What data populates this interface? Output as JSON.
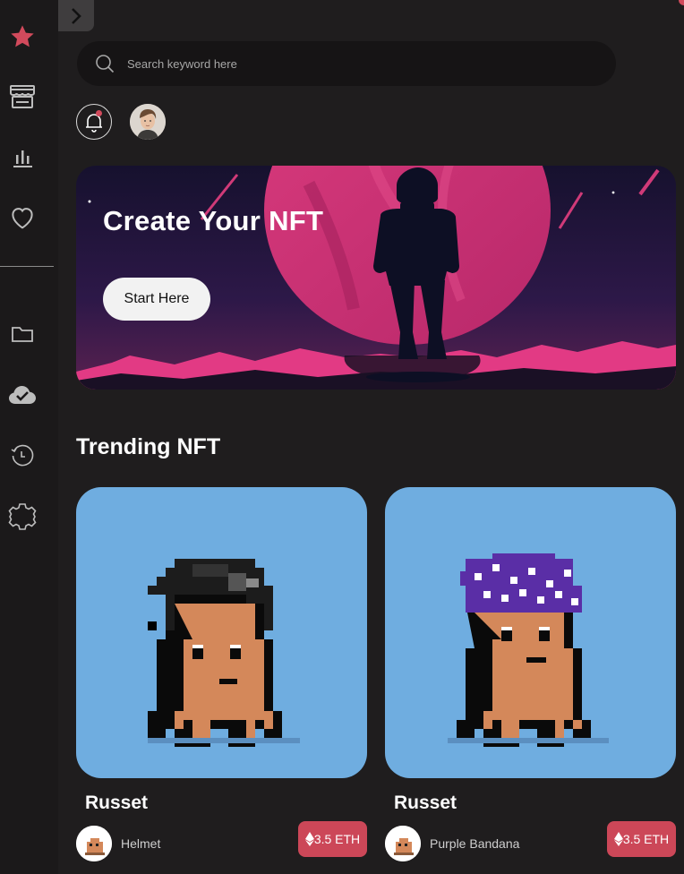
{
  "sidebar": {
    "items": [
      {
        "icon": "star-icon",
        "active": true
      },
      {
        "icon": "store-icon"
      },
      {
        "icon": "chart-icon"
      },
      {
        "icon": "heart-icon"
      },
      {
        "icon": "folder-icon"
      },
      {
        "icon": "cloud-check-icon"
      },
      {
        "icon": "history-icon"
      },
      {
        "icon": "settings-icon"
      }
    ]
  },
  "header": {
    "search_placeholder": "Search keyword here"
  },
  "hero": {
    "title": "Create Your NFT",
    "button_label": "Start Here"
  },
  "trending": {
    "title": "Trending NFT",
    "cards": [
      {
        "name": "Russet",
        "creator": "Helmet",
        "price": "3.5 ETH"
      },
      {
        "name": "Russet",
        "creator": "Purple Bandana",
        "price": "3.5 ETH"
      }
    ]
  },
  "colors": {
    "accent": "#d24a5c",
    "background": "#1f1d1e",
    "card_bg": "#6fade0",
    "price_badge": "#cc4758"
  }
}
